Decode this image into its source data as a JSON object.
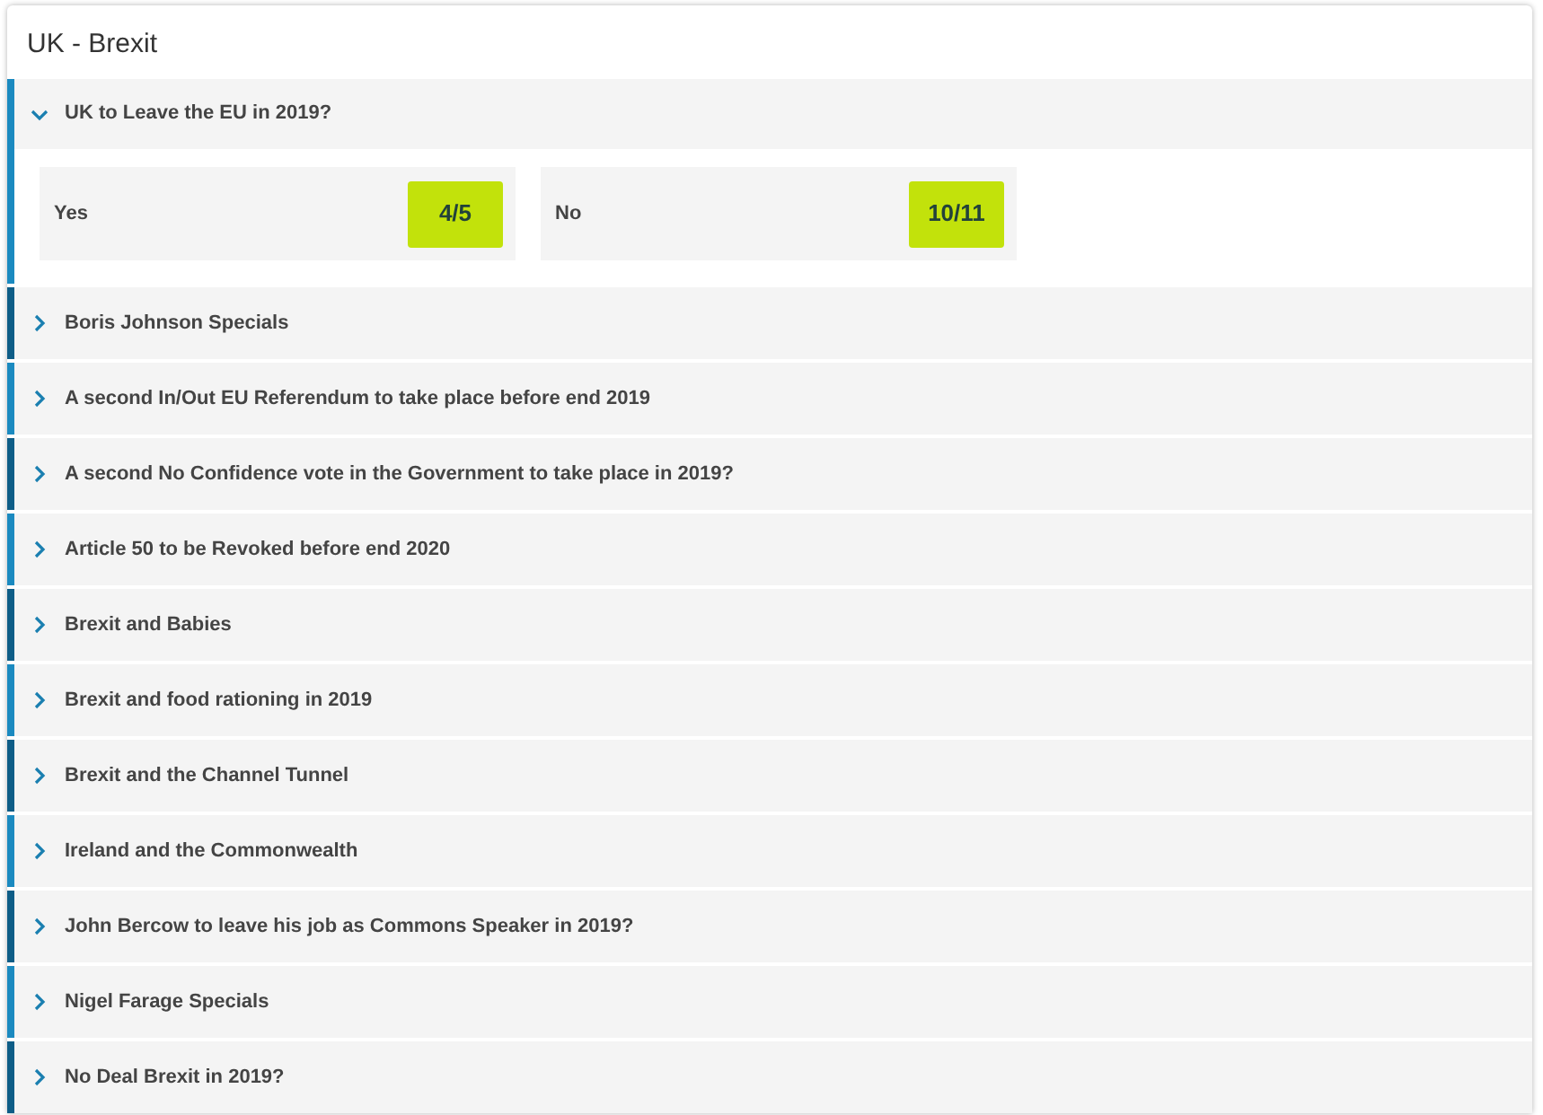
{
  "title": "UK - Brexit",
  "markets": [
    {
      "name": "UK to Leave the EU in 2019?",
      "expanded": true,
      "selections": [
        {
          "label": "Yes",
          "odds": "4/5"
        },
        {
          "label": "No",
          "odds": "10/11"
        }
      ]
    },
    {
      "name": "Boris Johnson Specials",
      "expanded": false
    },
    {
      "name": "A second In/Out EU Referendum to take place before end 2019",
      "expanded": false
    },
    {
      "name": "A second No Confidence vote in the Government to take place in 2019?",
      "expanded": false
    },
    {
      "name": "Article 50 to be Revoked before end 2020",
      "expanded": false
    },
    {
      "name": "Brexit and Babies",
      "expanded": false
    },
    {
      "name": "Brexit and food rationing in 2019",
      "expanded": false
    },
    {
      "name": "Brexit and the Channel Tunnel",
      "expanded": false
    },
    {
      "name": "Ireland and the Commonwealth",
      "expanded": false
    },
    {
      "name": "John Bercow to leave his job as Commons Speaker in 2019?",
      "expanded": false
    },
    {
      "name": "Nigel Farage Specials",
      "expanded": false
    },
    {
      "name": "No Deal Brexit in 2019?",
      "expanded": false
    }
  ]
}
